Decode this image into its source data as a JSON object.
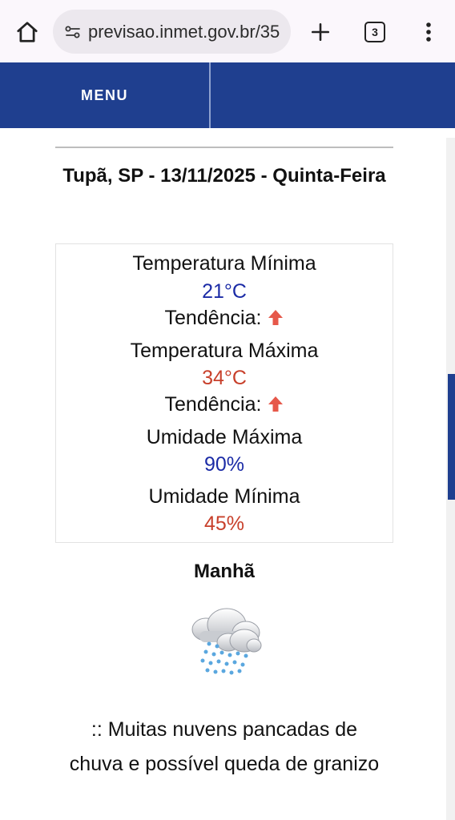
{
  "browser": {
    "url": "previsao.inmet.gov.br/35",
    "tab_count": "3",
    "icons": [
      "home-icon",
      "site-settings-icon",
      "plus-icon",
      "tabs-icon",
      "kebab-menu-icon"
    ]
  },
  "nav": {
    "menu_label": "MENU",
    "color": "#1f3f8f"
  },
  "forecast": {
    "title": "Tupã, SP - 13/11/2025 - Quinta-Feira",
    "temp_min_label": "Temperatura Mínima",
    "temp_min_value": "21°C",
    "trend_label_1": "Tendência:",
    "temp_max_label": "Temperatura Máxima",
    "temp_max_value": "34°C",
    "trend_label_2": "Tendência:",
    "hum_max_label": "Umidade Máxima",
    "hum_max_value": "90%",
    "hum_min_label": "Umidade Mínima",
    "hum_min_value": "45%",
    "trend_icon": "arrow-up-icon",
    "colors": {
      "min": "#1b2ba6",
      "max": "#c8402b"
    }
  },
  "period": {
    "name": "Manhã",
    "icon": "cloud-rain-hail-icon",
    "description": ":: Muitas nuvens pancadas de chuva e possível queda de granizo"
  }
}
